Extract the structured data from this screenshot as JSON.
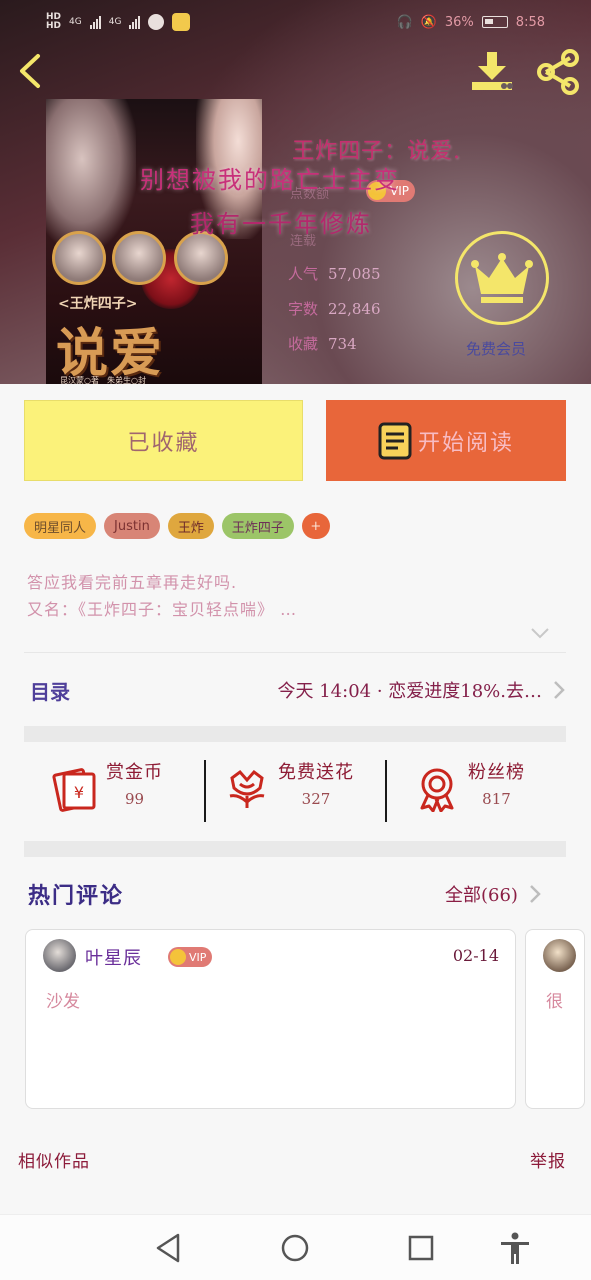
{
  "status_bar": {
    "network_left": "4G",
    "network_right": "4G",
    "battery": "36%",
    "time": "8:58"
  },
  "header": {
    "back_icon": "chevron-left-icon",
    "download_icon": "download-icon",
    "share_icon": "share-icon"
  },
  "book": {
    "title": "王炸四子：说爱.",
    "overlay_line1": "别想被我的路亡士主变",
    "overlay_line2": "我有一千年修炼",
    "faint_line1": "点数额",
    "faint_line2": "连载",
    "vip_label": "VIP",
    "cover": {
      "subtitle": "<王炸四子>",
      "title": "说爱",
      "credit": "昆汉蒙○著　朱弟生○封"
    },
    "stats": {
      "popularity_label": "人气",
      "popularity_value": "57,085",
      "words_label": "字数",
      "words_value": "22,846",
      "collect_label": "收藏",
      "collect_value": "734"
    },
    "member_label": "免费会员",
    "member_icon": "crown-icon"
  },
  "actions": {
    "collected_label": "已收藏",
    "read_label": "开始阅读",
    "read_icon": "book-icon"
  },
  "tags": [
    "明星同人",
    "Justin",
    "王炸",
    "王炸四子",
    "+"
  ],
  "description": {
    "line1": "答应我看完前五章再走好吗.",
    "line2": "又名：《王炸四子：宝贝轻点喘》 …"
  },
  "catalog": {
    "title": "目录",
    "latest": "今天 14:04 · 恋爱进度18%.去…"
  },
  "rewards": [
    {
      "name": "赏金币",
      "count": "99",
      "icon": "red-envelope-icon"
    },
    {
      "name": "免费送花",
      "count": "327",
      "icon": "flower-icon"
    },
    {
      "name": "粉丝榜",
      "count": "817",
      "icon": "medal-icon"
    }
  ],
  "comments": {
    "title": "热门评论",
    "all_label": "全部(66)",
    "items": [
      {
        "user": "叶星辰",
        "vip": "VIP",
        "date": "02-14",
        "text": "沙发"
      },
      {
        "text": "很"
      }
    ]
  },
  "footer": {
    "similar": "相似作品",
    "report": "举报"
  },
  "colors": {
    "accent_orange": "#e8663a",
    "collected_yellow": "#fbf27a",
    "crown_yellow": "#f4e66a"
  }
}
